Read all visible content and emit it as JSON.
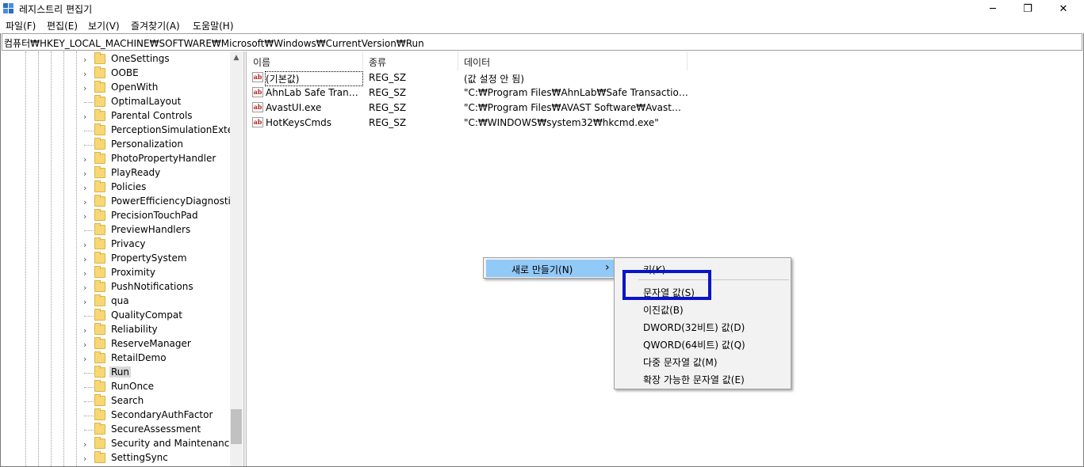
{
  "window": {
    "title": "레지스트리 편집기",
    "minimize": "─",
    "maximize": "❐",
    "close": "✕"
  },
  "menu": [
    "파일(F)",
    "편집(E)",
    "보기(V)",
    "즐겨찾기(A)",
    "도움말(H)"
  ],
  "address": "컴퓨터₩HKEY_LOCAL_MACHINE₩SOFTWARE₩Microsoft₩Windows₩CurrentVersion₩Run",
  "tree": {
    "items": [
      {
        "label": "OneSettings",
        "expandable": true
      },
      {
        "label": "OOBE",
        "expandable": true
      },
      {
        "label": "OpenWith",
        "expandable": true
      },
      {
        "label": "OptimalLayout",
        "expandable": false
      },
      {
        "label": "Parental Controls",
        "expandable": true
      },
      {
        "label": "PerceptionSimulationExtens",
        "expandable": false
      },
      {
        "label": "Personalization",
        "expandable": false
      },
      {
        "label": "PhotoPropertyHandler",
        "expandable": true
      },
      {
        "label": "PlayReady",
        "expandable": true
      },
      {
        "label": "Policies",
        "expandable": true
      },
      {
        "label": "PowerEfficiencyDiagnostics",
        "expandable": true
      },
      {
        "label": "PrecisionTouchPad",
        "expandable": true
      },
      {
        "label": "PreviewHandlers",
        "expandable": false
      },
      {
        "label": "Privacy",
        "expandable": true
      },
      {
        "label": "PropertySystem",
        "expandable": true
      },
      {
        "label": "Proximity",
        "expandable": true
      },
      {
        "label": "PushNotifications",
        "expandable": true
      },
      {
        "label": "qua",
        "expandable": true
      },
      {
        "label": "QualityCompat",
        "expandable": false
      },
      {
        "label": "Reliability",
        "expandable": true
      },
      {
        "label": "ReserveManager",
        "expandable": true
      },
      {
        "label": "RetailDemo",
        "expandable": true
      },
      {
        "label": "Run",
        "expandable": false,
        "selected": true
      },
      {
        "label": "RunOnce",
        "expandable": false
      },
      {
        "label": "Search",
        "expandable": false
      },
      {
        "label": "SecondaryAuthFactor",
        "expandable": false
      },
      {
        "label": "SecureAssessment",
        "expandable": false
      },
      {
        "label": "Security and Maintenance",
        "expandable": true
      },
      {
        "label": "SettingSync",
        "expandable": true
      }
    ]
  },
  "columns": {
    "name": "이름",
    "type": "종류",
    "data": "데이터"
  },
  "values": [
    {
      "name": "(기본값)",
      "type": "REG_SZ",
      "data": "(값 설정 안 됨)"
    },
    {
      "name": "AhnLab Safe Transac...",
      "type": "REG_SZ",
      "data": "\"C:₩Program Files₩AhnLab₩Safe Transaction₩st..."
    },
    {
      "name": "AvastUI.exe",
      "type": "REG_SZ",
      "data": "\"C:₩Program Files₩AVAST Software₩Avast₩AvL..."
    },
    {
      "name": "HotKeysCmds",
      "type": "REG_SZ",
      "data": "\"C:₩WINDOWS₩system32₩hkcmd.exe\""
    }
  ],
  "value_icon": "ab",
  "context_menu": {
    "new_label": "새로 만들기(N)",
    "arrow": "›"
  },
  "submenu": {
    "key_label": "키(K)",
    "items": [
      "문자열 값(S)",
      "이진값(B)",
      "DWORD(32비트) 값(D)",
      "QWORD(64비트) 값(Q)",
      "다중 문자열 값(M)",
      "확장 가능한 문자열 값(E)"
    ]
  },
  "colors": {
    "highlight_box": "#0a14c8",
    "menu_active": "#91c9f7",
    "folder": "#f8d775"
  }
}
